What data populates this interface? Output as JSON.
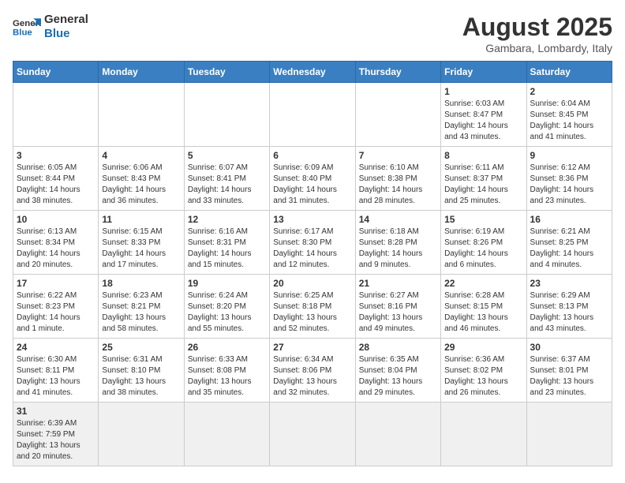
{
  "logo": {
    "text_general": "General",
    "text_blue": "Blue"
  },
  "title": "August 2025",
  "subtitle": "Gambara, Lombardy, Italy",
  "days_header": [
    "Sunday",
    "Monday",
    "Tuesday",
    "Wednesday",
    "Thursday",
    "Friday",
    "Saturday"
  ],
  "weeks": [
    [
      {
        "day": "",
        "info": ""
      },
      {
        "day": "",
        "info": ""
      },
      {
        "day": "",
        "info": ""
      },
      {
        "day": "",
        "info": ""
      },
      {
        "day": "",
        "info": ""
      },
      {
        "day": "1",
        "info": "Sunrise: 6:03 AM\nSunset: 8:47 PM\nDaylight: 14 hours and 43 minutes."
      },
      {
        "day": "2",
        "info": "Sunrise: 6:04 AM\nSunset: 8:45 PM\nDaylight: 14 hours and 41 minutes."
      }
    ],
    [
      {
        "day": "3",
        "info": "Sunrise: 6:05 AM\nSunset: 8:44 PM\nDaylight: 14 hours and 38 minutes."
      },
      {
        "day": "4",
        "info": "Sunrise: 6:06 AM\nSunset: 8:43 PM\nDaylight: 14 hours and 36 minutes."
      },
      {
        "day": "5",
        "info": "Sunrise: 6:07 AM\nSunset: 8:41 PM\nDaylight: 14 hours and 33 minutes."
      },
      {
        "day": "6",
        "info": "Sunrise: 6:09 AM\nSunset: 8:40 PM\nDaylight: 14 hours and 31 minutes."
      },
      {
        "day": "7",
        "info": "Sunrise: 6:10 AM\nSunset: 8:38 PM\nDaylight: 14 hours and 28 minutes."
      },
      {
        "day": "8",
        "info": "Sunrise: 6:11 AM\nSunset: 8:37 PM\nDaylight: 14 hours and 25 minutes."
      },
      {
        "day": "9",
        "info": "Sunrise: 6:12 AM\nSunset: 8:36 PM\nDaylight: 14 hours and 23 minutes."
      }
    ],
    [
      {
        "day": "10",
        "info": "Sunrise: 6:13 AM\nSunset: 8:34 PM\nDaylight: 14 hours and 20 minutes."
      },
      {
        "day": "11",
        "info": "Sunrise: 6:15 AM\nSunset: 8:33 PM\nDaylight: 14 hours and 17 minutes."
      },
      {
        "day": "12",
        "info": "Sunrise: 6:16 AM\nSunset: 8:31 PM\nDaylight: 14 hours and 15 minutes."
      },
      {
        "day": "13",
        "info": "Sunrise: 6:17 AM\nSunset: 8:30 PM\nDaylight: 14 hours and 12 minutes."
      },
      {
        "day": "14",
        "info": "Sunrise: 6:18 AM\nSunset: 8:28 PM\nDaylight: 14 hours and 9 minutes."
      },
      {
        "day": "15",
        "info": "Sunrise: 6:19 AM\nSunset: 8:26 PM\nDaylight: 14 hours and 6 minutes."
      },
      {
        "day": "16",
        "info": "Sunrise: 6:21 AM\nSunset: 8:25 PM\nDaylight: 14 hours and 4 minutes."
      }
    ],
    [
      {
        "day": "17",
        "info": "Sunrise: 6:22 AM\nSunset: 8:23 PM\nDaylight: 14 hours and 1 minute."
      },
      {
        "day": "18",
        "info": "Sunrise: 6:23 AM\nSunset: 8:21 PM\nDaylight: 13 hours and 58 minutes."
      },
      {
        "day": "19",
        "info": "Sunrise: 6:24 AM\nSunset: 8:20 PM\nDaylight: 13 hours and 55 minutes."
      },
      {
        "day": "20",
        "info": "Sunrise: 6:25 AM\nSunset: 8:18 PM\nDaylight: 13 hours and 52 minutes."
      },
      {
        "day": "21",
        "info": "Sunrise: 6:27 AM\nSunset: 8:16 PM\nDaylight: 13 hours and 49 minutes."
      },
      {
        "day": "22",
        "info": "Sunrise: 6:28 AM\nSunset: 8:15 PM\nDaylight: 13 hours and 46 minutes."
      },
      {
        "day": "23",
        "info": "Sunrise: 6:29 AM\nSunset: 8:13 PM\nDaylight: 13 hours and 43 minutes."
      }
    ],
    [
      {
        "day": "24",
        "info": "Sunrise: 6:30 AM\nSunset: 8:11 PM\nDaylight: 13 hours and 41 minutes."
      },
      {
        "day": "25",
        "info": "Sunrise: 6:31 AM\nSunset: 8:10 PM\nDaylight: 13 hours and 38 minutes."
      },
      {
        "day": "26",
        "info": "Sunrise: 6:33 AM\nSunset: 8:08 PM\nDaylight: 13 hours and 35 minutes."
      },
      {
        "day": "27",
        "info": "Sunrise: 6:34 AM\nSunset: 8:06 PM\nDaylight: 13 hours and 32 minutes."
      },
      {
        "day": "28",
        "info": "Sunrise: 6:35 AM\nSunset: 8:04 PM\nDaylight: 13 hours and 29 minutes."
      },
      {
        "day": "29",
        "info": "Sunrise: 6:36 AM\nSunset: 8:02 PM\nDaylight: 13 hours and 26 minutes."
      },
      {
        "day": "30",
        "info": "Sunrise: 6:37 AM\nSunset: 8:01 PM\nDaylight: 13 hours and 23 minutes."
      }
    ],
    [
      {
        "day": "31",
        "info": "Sunrise: 6:39 AM\nSunset: 7:59 PM\nDaylight: 13 hours and 20 minutes."
      },
      {
        "day": "",
        "info": ""
      },
      {
        "day": "",
        "info": ""
      },
      {
        "day": "",
        "info": ""
      },
      {
        "day": "",
        "info": ""
      },
      {
        "day": "",
        "info": ""
      },
      {
        "day": "",
        "info": ""
      }
    ]
  ]
}
